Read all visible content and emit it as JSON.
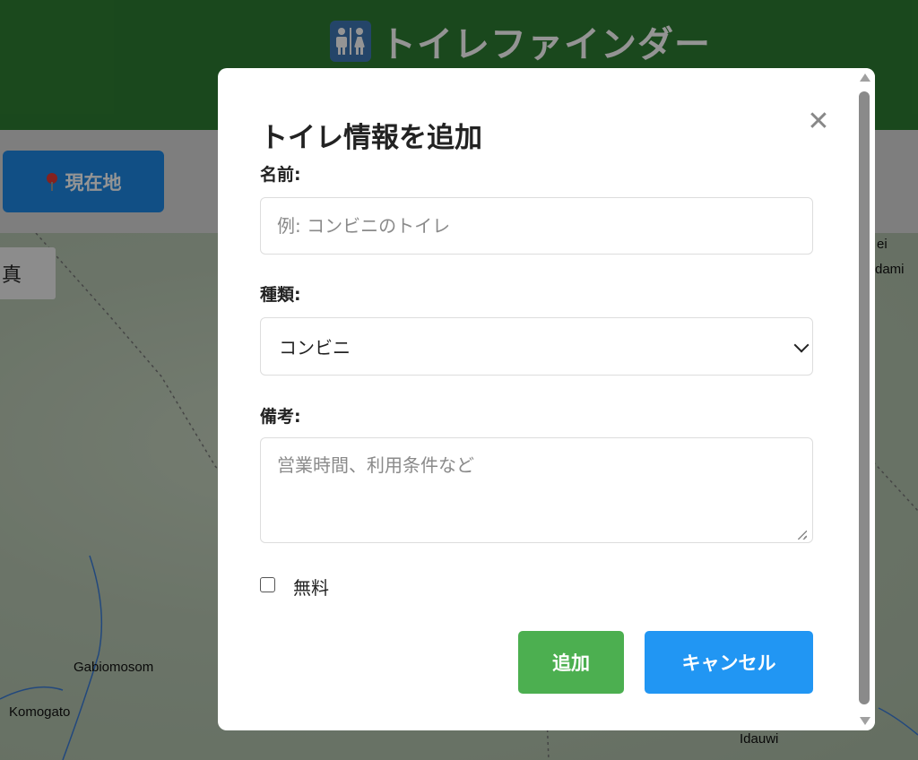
{
  "header": {
    "title": "トイレファインダー",
    "icon": "restroom-icon"
  },
  "toolbar": {
    "locate_label": "現在地",
    "locate_icon": "map-pin-icon"
  },
  "map": {
    "layer_button_label": "真",
    "labels": {
      "gabiomosom": "Gabiomosom",
      "komogato": "Komogato",
      "idauwi": "Idauwi",
      "ei": "ei",
      "dami": "dami"
    }
  },
  "modal": {
    "title": "トイレ情報を追加",
    "close_icon": "close-icon",
    "name_label": "名前:",
    "name_placeholder": "例: コンビニのトイレ",
    "type_label": "種類:",
    "type_selected": "コンビニ",
    "notes_label": "備考:",
    "notes_placeholder": "営業時間、利用条件など",
    "free_label": "無料",
    "free_checked": false,
    "add_label": "追加",
    "cancel_label": "キャンセル"
  },
  "colors": {
    "header": "#2e7d32",
    "primary_blue": "#2196f3",
    "locate_blue": "#1e88e5",
    "add_green": "#4caf50"
  }
}
